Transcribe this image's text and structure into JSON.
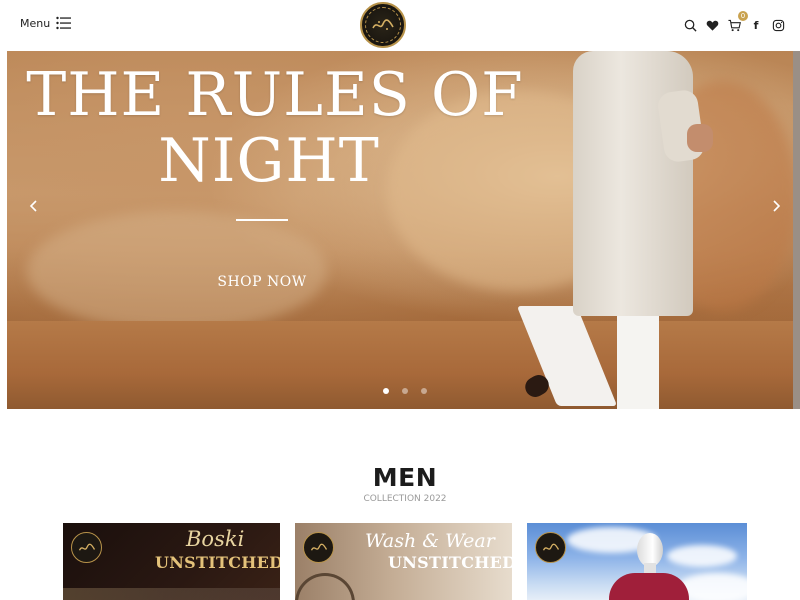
{
  "header": {
    "menu_label": "Menu",
    "icons": [
      "menu-list-icon",
      "search-icon",
      "heart-icon",
      "cart-icon",
      "facebook-icon",
      "instagram-icon"
    ],
    "cart_count": "0",
    "facebook_glyph": "f"
  },
  "hero": {
    "title_line1": "THE RULES OF",
    "title_line2": "NIGHT",
    "cta_label": "SHOP NOW",
    "slides_total": 3,
    "active_slide": 1
  },
  "section": {
    "title": "MEN",
    "subtitle": "COLLECTION 2022"
  },
  "cards": [
    {
      "script": "Boski",
      "caps": "UNSTITCHED"
    },
    {
      "script": "Wash & Wear",
      "caps": "UNSTITCHED"
    },
    {
      "script": "",
      "caps": ""
    }
  ],
  "colors": {
    "accent_gold": "#c9a24f",
    "text_dark": "#1c1c1c",
    "subtitle_gray": "#9a9a9a"
  }
}
